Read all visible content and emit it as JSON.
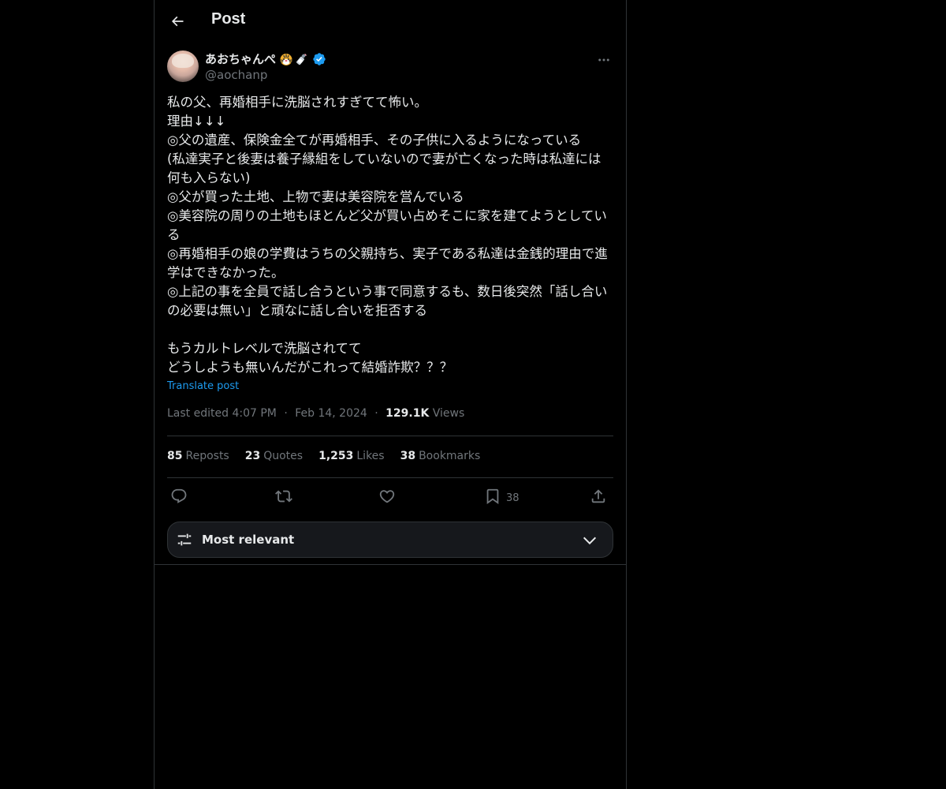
{
  "header": {
    "title": "Post",
    "back_icon": "arrow-left-icon"
  },
  "author": {
    "name": "あおちゃんぺ",
    "emoji": [
      "tiger-face-emoji",
      "baby-bottle-emoji"
    ],
    "verified": true,
    "handle": "@aochanp",
    "avatar": "avatar-photo"
  },
  "post": {
    "text": "私の父、再婚相手に洗脳されすぎてて怖い。\n理由↓↓↓\n◎父の遺産、保険金全てが再婚相手、その子供に入るようになっている\n(私達実子と後妻は養子縁組をしていないので妻が亡くなった時は私達には何も入らない)\n◎父が買った土地、上物で妻は美容院を営んでいる\n◎美容院の周りの土地もほとんど父が買い占めそこに家を建てようとしている\n◎再婚相手の娘の学費はうちの父親持ち、実子である私達は金銭的理由で進学はできなかった。\n◎上記の事を全員で話し合うという事で同意するも、数日後突然「話し合いの必要は無い」と頑なに話し合いを拒否する\n\nもうカルトレベルで洗脳されてて\nどうしようも無いんだがこれって結婚詐欺？？？",
    "translate_label": "Translate post",
    "edited_prefix": "Last edited 4:07 PM",
    "date": "Feb 14, 2024",
    "separator": "·",
    "views_count": "129.1K",
    "views_label": "Views"
  },
  "stats": {
    "reposts_count": "85",
    "reposts_label": "Reposts",
    "quotes_count": "23",
    "quotes_label": "Quotes",
    "likes_count": "1,253",
    "likes_label": "Likes",
    "bookmarks_count": "38",
    "bookmarks_label": "Bookmarks"
  },
  "actions": {
    "bookmark_count": "38"
  },
  "sort": {
    "label": "Most relevant"
  },
  "colors": {
    "background": "#000000",
    "text": "#e7e9ea",
    "muted": "#71767b",
    "link": "#1d9bf0",
    "border": "#2f3336",
    "verified": "#1d9bf0"
  }
}
